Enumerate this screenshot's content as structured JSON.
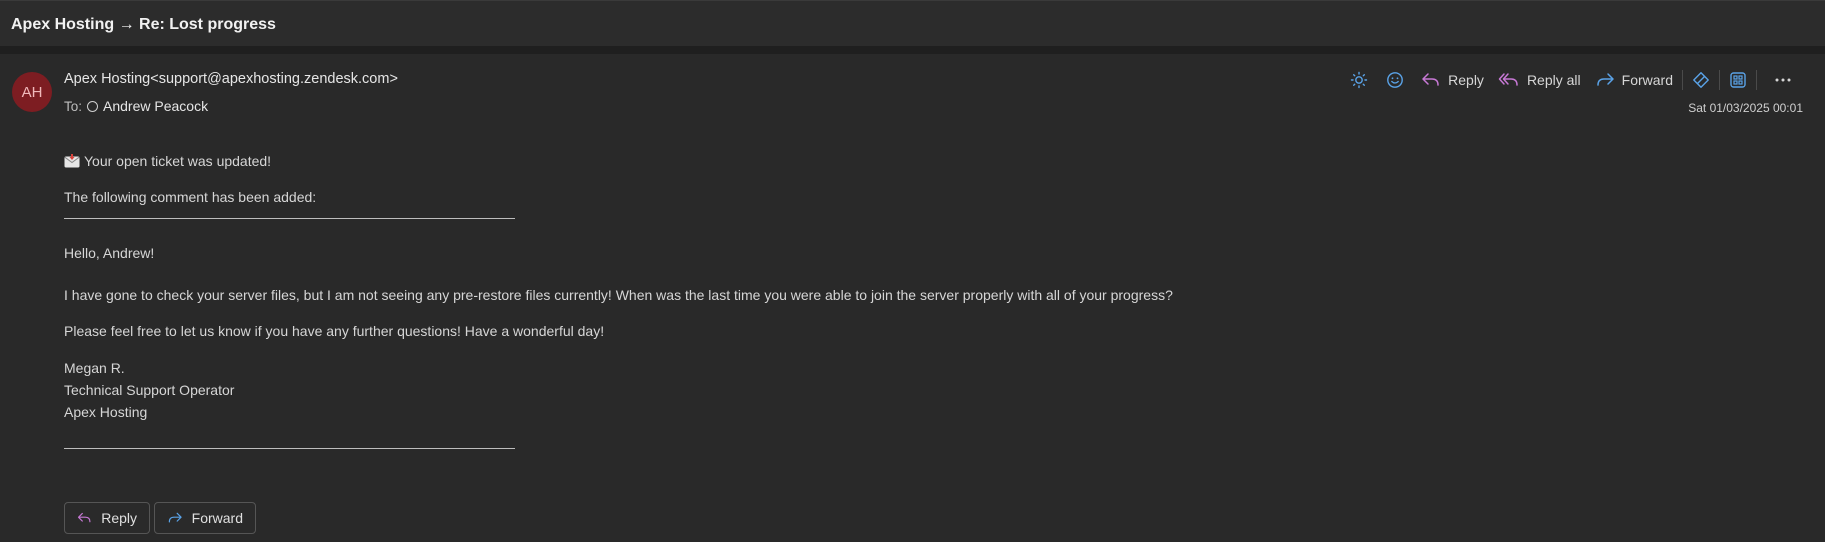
{
  "window": {
    "title": "Apex Hosting → Re: Lost progress"
  },
  "sender": {
    "initials": "AH",
    "from": "Apex Hosting<support@apexhosting.zendesk.com>",
    "to_label": "To:",
    "recipient": "Andrew Peacock",
    "date": "Sat 01/03/2025 00:01"
  },
  "toolbar": {
    "reply": "Reply",
    "reply_all": "Reply all",
    "forward": "Forward",
    "icons": [
      "sun-icon",
      "emoji-icon",
      "reply-icon",
      "reply-all-icon",
      "forward-icon",
      "designer-icon",
      "apps-icon",
      "more-icon"
    ]
  },
  "message": {
    "headline": "Your open ticket was updated!",
    "intro": "The following comment has been added:",
    "greeting": "Hello, Andrew!",
    "paragraph1": "I have gone to check your server files, but I am not seeing any pre-restore files currently! When was the last time you were able to join the server properly with all of your progress?",
    "paragraph2": "Please feel free to let us know if you have any further questions! Have a wonderful day!",
    "signature_name": "Megan R.",
    "signature_title": "Technical Support Operator",
    "signature_company": "Apex Hosting"
  },
  "footer_buttons": {
    "reply": "Reply",
    "forward": "Forward"
  },
  "colors": {
    "background": "#292929",
    "avatar": "#7d1d22",
    "reply_accent": "#c879d6",
    "forward_accent": "#5aa3e8"
  }
}
